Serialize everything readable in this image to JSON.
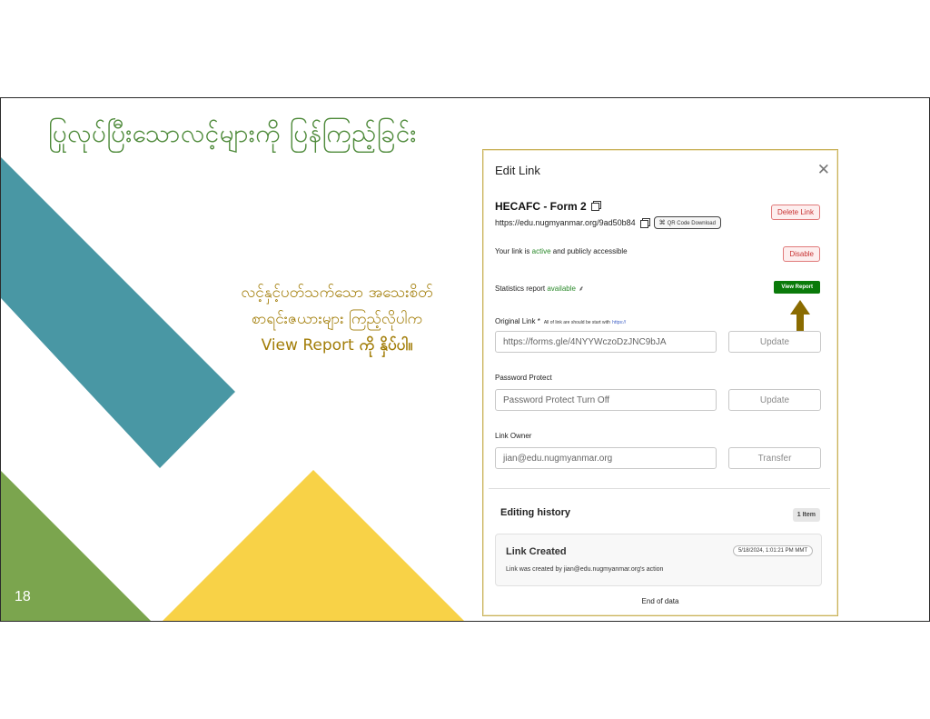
{
  "slide": {
    "title": "ပြုလုပ်ပြီးသောလင့်များကို ပြန်ကြည့်ခြင်း",
    "number": "18",
    "instruction": {
      "line1": "လင့်နှင့်ပတ်သက်သော အသေးစိတ်",
      "line2": "စာရင်းဇယားများ ကြည့်လိုပါက",
      "line3_prefix": "View Report",
      "line3_suffix": " ကို နှိပ်ပါ။"
    },
    "colors": {
      "teal": "#4997a4",
      "green": "#7ba54e",
      "yellow": "#f8d247",
      "title_green": "#4e8a3a",
      "instruction_gold": "#a27d08"
    }
  },
  "dialog": {
    "title": "Edit Link",
    "close_icon": "close-icon",
    "link_name": "HECAFC - Form 2",
    "link_url": "https://edu.nugmyanmar.org/9ad50b84",
    "qr_button": "QR Code Download",
    "delete_button": "Delete Link",
    "status": {
      "prefix": "Your link is ",
      "active": "active",
      "suffix": " and publicly accessible"
    },
    "disable_button": "Disable",
    "stats": {
      "prefix": "Statistics report ",
      "available": "available",
      "icon": "chart-icon"
    },
    "view_report_button": "View Report",
    "original_link": {
      "label": "Original Link",
      "required_mark": "*",
      "hint": "All of link are should be start with",
      "hint_link": "https://",
      "value": "https://forms.gle/4NYYWczoDzJNC9bJA",
      "button": "Update"
    },
    "password": {
      "label": "Password Protect",
      "value": "Password Protect Turn Off",
      "button": "Update"
    },
    "owner": {
      "label": "Link Owner",
      "value": "jian@edu.nugmyanmar.org",
      "button": "Transfer"
    },
    "history": {
      "title": "Editing history",
      "count_badge": "1 Item",
      "items": [
        {
          "title": "Link Created",
          "date": "5/18/2024, 1:01:21 PM MMT",
          "desc_prefix": "Link was created by ",
          "desc_user": "jian@edu.nugmyanmar.org",
          "desc_suffix": "'s action"
        }
      ],
      "end_text": "End of data"
    }
  }
}
